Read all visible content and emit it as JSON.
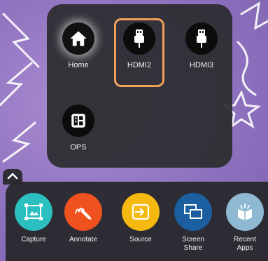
{
  "source_panel": {
    "items": [
      {
        "label": "Home",
        "icon": "home-icon"
      },
      {
        "label": "HDMI2",
        "icon": "hdmi-icon",
        "selected": true
      },
      {
        "label": "HDMI3",
        "icon": "hdmi-icon"
      },
      {
        "label": "OPS",
        "icon": "ops-icon"
      }
    ],
    "selected_color": "#f0a05a"
  },
  "dock": {
    "toggle_icon": "chevron-up-icon",
    "items": [
      {
        "label": "Capture",
        "icon": "capture-icon",
        "color": "#2bbfc0"
      },
      {
        "label": "Annotate",
        "icon": "annotate-icon",
        "color": "#f0521f"
      },
      {
        "label": "Source",
        "icon": "source-icon",
        "color": "#f5b912"
      },
      {
        "label_line1": "Screen",
        "label_line2": "Share",
        "icon": "screen-share-icon",
        "color": "#1b5fa0"
      },
      {
        "label_line1": "Recent",
        "label_line2": "Apps",
        "icon": "recent-apps-icon",
        "color": "#8fb8d2"
      }
    ]
  }
}
